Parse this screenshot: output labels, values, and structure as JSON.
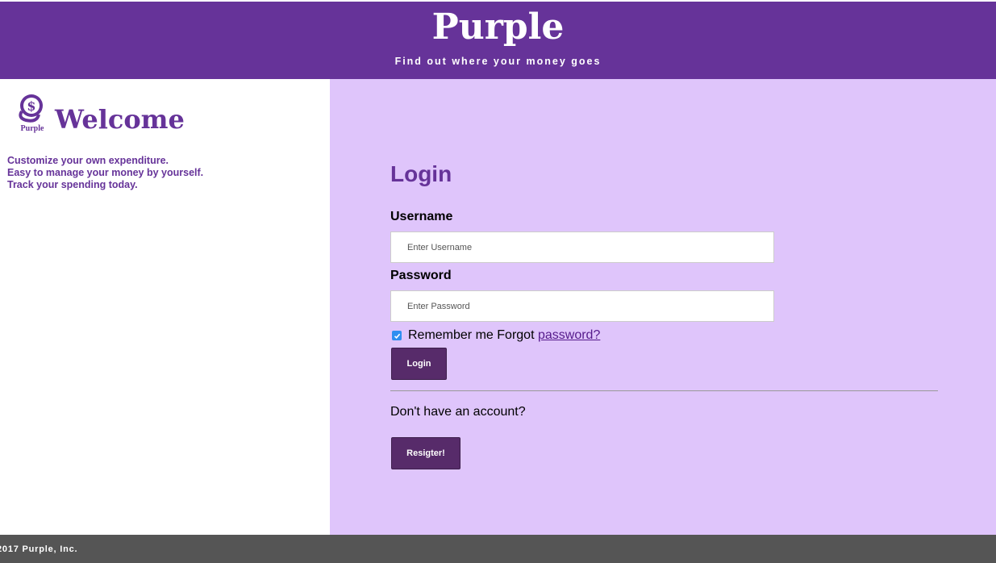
{
  "header": {
    "brand": "Purple",
    "tagline": "Find out where your money goes"
  },
  "welcome": {
    "logo_text": "Purple",
    "title": "Welcome",
    "lines": [
      "Customize your own expenditure.",
      "Easy to manage your money by yourself.",
      "Track your spending today."
    ]
  },
  "login": {
    "title": "Login",
    "username_label": "Username",
    "username_placeholder": "Enter Username",
    "password_label": "Password",
    "password_placeholder": "Enter Password",
    "remember_checked": true,
    "remember_label": "Remember me",
    "forgot_prefix": "Forgot",
    "forgot_link": "password?",
    "login_button": "Login",
    "no_account": "Don't have an account?",
    "register_button": "Resigter!"
  },
  "footer": {
    "copyright": "2017 Purple, Inc."
  },
  "colors": {
    "header": "#663399",
    "form_panel": "#dfc5fb",
    "button": "#572b6a",
    "footer": "#555555"
  }
}
